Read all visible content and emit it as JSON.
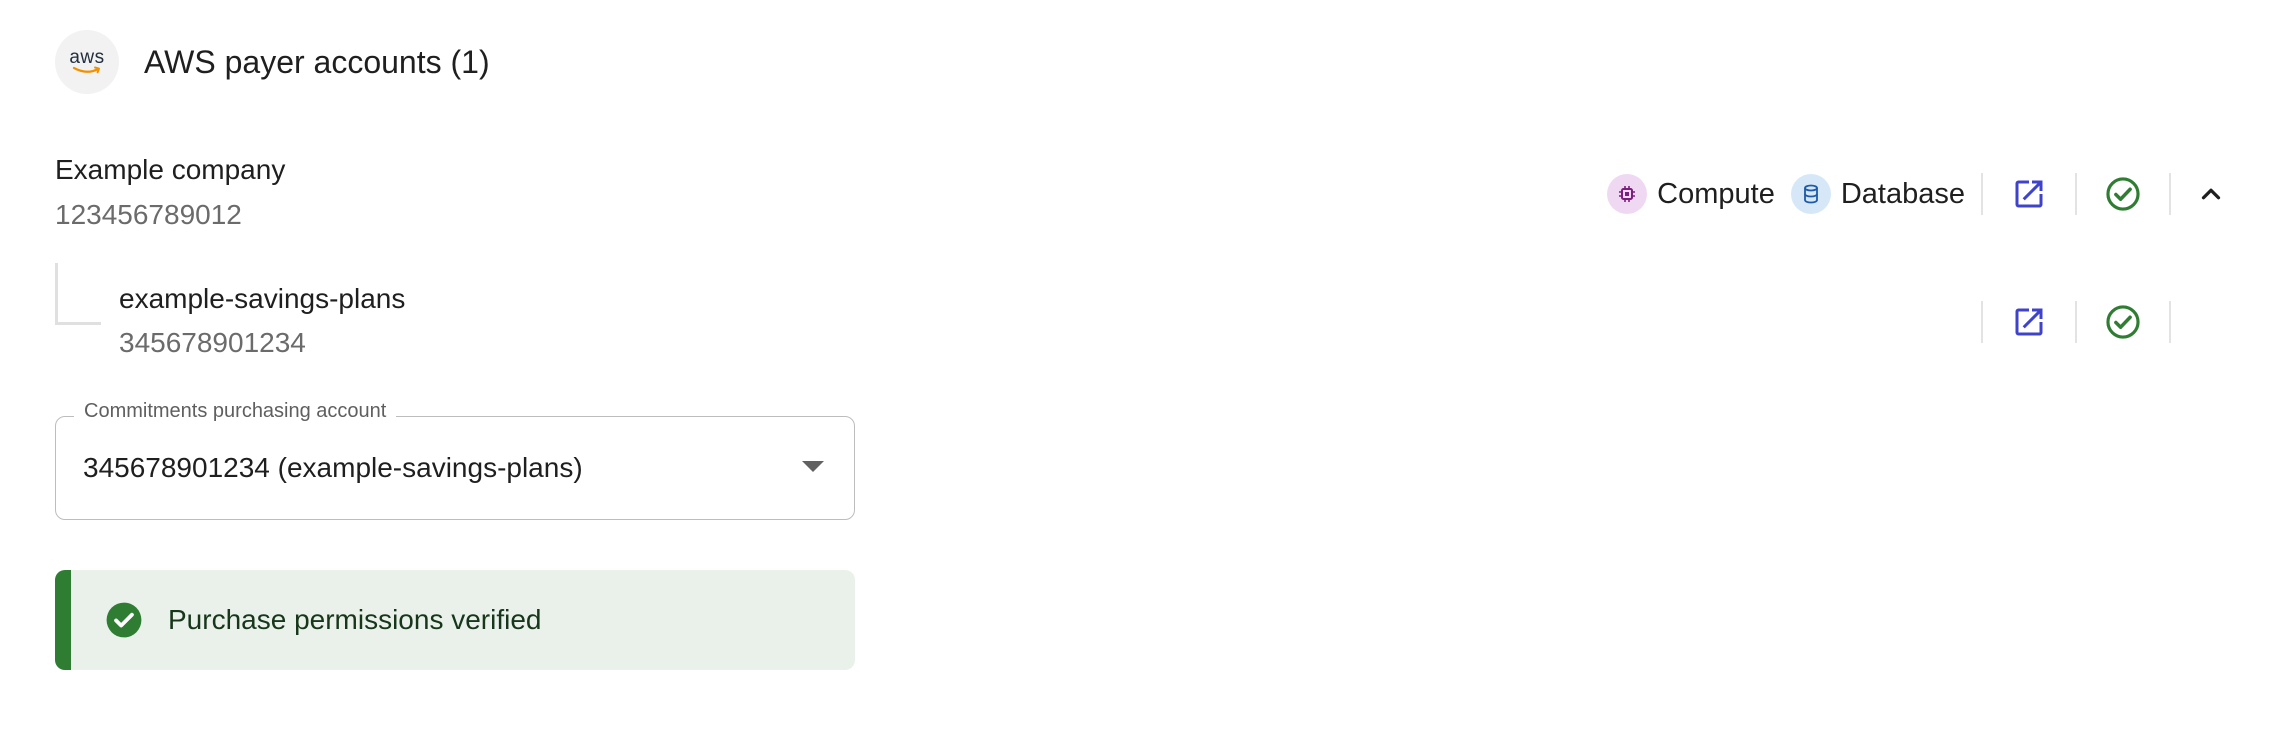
{
  "header": {
    "logo_text": "aws",
    "title": "AWS payer accounts (1)"
  },
  "payer_account": {
    "name": "Example company",
    "id": "123456789012",
    "chips": [
      {
        "label": "Compute",
        "icon": "cpu-chip-icon",
        "color": "#7a1f7d",
        "bg": "#efd9f2"
      },
      {
        "label": "Database",
        "icon": "database-icon",
        "color": "#1e5aa8",
        "bg": "#d6e8f7"
      }
    ]
  },
  "linked_account": {
    "name": "example-savings-plans",
    "id": "345678901234"
  },
  "commitments_select": {
    "label": "Commitments purchasing account",
    "value": "345678901234 (example-savings-plans)"
  },
  "alert": {
    "text": "Purchase permissions verified",
    "color": "#2f7d32"
  },
  "colors": {
    "accent": "#3f43c9",
    "success": "#2f7d32"
  }
}
